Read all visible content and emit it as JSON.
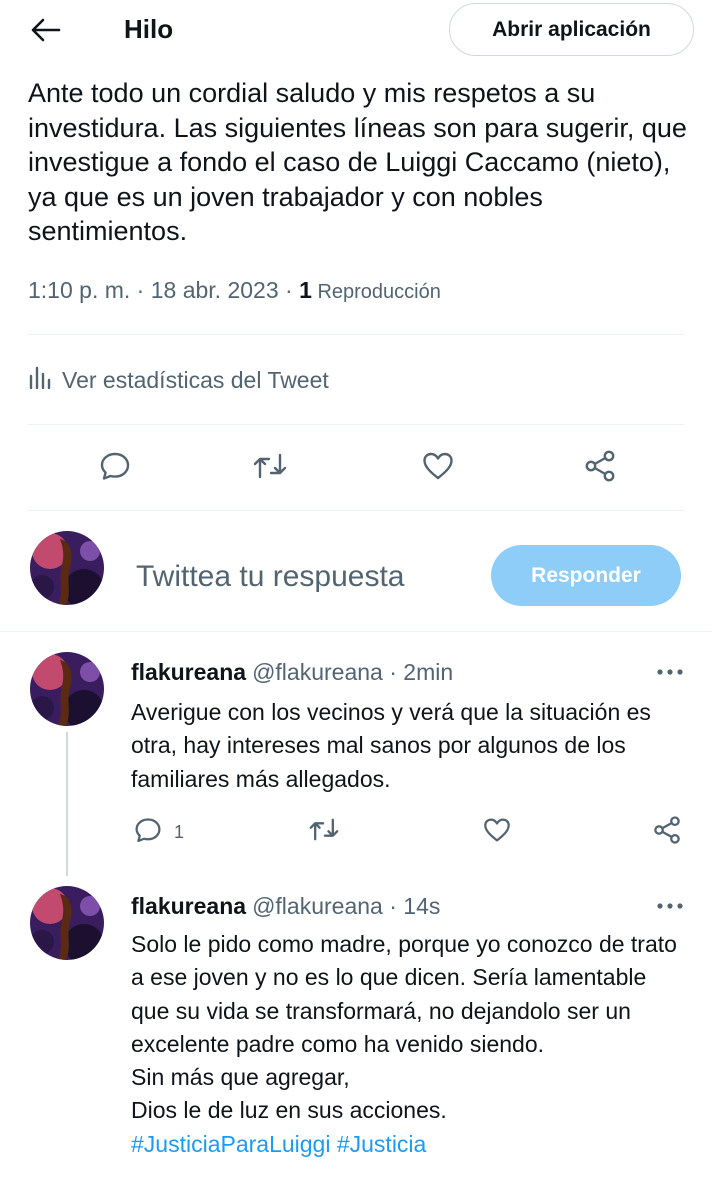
{
  "header": {
    "title": "Hilo",
    "open_app_label": "Abrir aplicación"
  },
  "tweet": {
    "text": "Ante todo un cordial saludo y mis respetos a su investidura. Las siguientes líneas son para sugerir, que investigue a fondo el caso de Luiggi Caccamo (nieto), ya que es un joven trabajador y con nobles sentimientos.",
    "time": "1:10 p. m.",
    "sep1": " · ",
    "date": "18 abr. 2023",
    "sep2": " · ",
    "views_count": "1",
    "views_label": " Reproducción",
    "stats_label": "Ver estadísticas del Tweet"
  },
  "compose": {
    "placeholder": "Twittea tu respuesta",
    "reply_button": "Responder"
  },
  "replies": [
    {
      "name": "flakureana",
      "handle": "@flakureana",
      "sep": " · ",
      "time": "2min",
      "text": "Averigue con los vecinos y verá que la situación es otra, hay intereses mal sanos por algunos de los familiares más allegados.",
      "reply_count": "1"
    },
    {
      "name": "flakureana",
      "handle": "@flakureana",
      "sep": " · ",
      "time": "14s",
      "lines": [
        "Solo le pido como madre, porque yo conozco de trato a ese joven y no es lo que dicen. Sería lamentable que su vida se transformará, no dejandolo ser un excelente padre como ha venido siendo.",
        "Sin más que  agregar,",
        "Dios le de luz en sus acciones."
      ],
      "hashtags": [
        "#JusticiaParaLuiggi",
        "#Justicia"
      ]
    }
  ],
  "colors": {
    "text": "#0f1419",
    "secondary": "#536471",
    "accent": "#1d9bf0",
    "reply_button_disabled": "#8ecdf8",
    "border": "#cfd9de"
  },
  "icons": {
    "back": "arrow-left-icon",
    "stats": "bar-chart-icon",
    "reply": "speech-bubble-icon",
    "retweet": "retweet-icon",
    "like": "heart-icon",
    "share": "share-icon",
    "more": "more-dots-icon"
  }
}
